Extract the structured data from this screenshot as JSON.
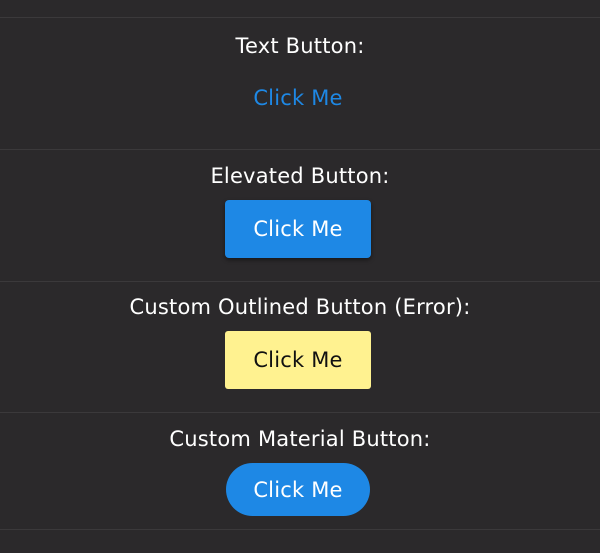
{
  "sections": {
    "text_button": {
      "label": "Text Button:",
      "button_label": "Click Me"
    },
    "elevated_button": {
      "label": "Elevated Button:",
      "button_label": "Click Me"
    },
    "outlined_button": {
      "label": "Custom Outlined Button (Error):",
      "button_label": "Click Me"
    },
    "material_button": {
      "label": "Custom Material Button:",
      "button_label": "Click Me"
    }
  },
  "colors": {
    "background": "#2b292b",
    "divider": "#3b393b",
    "accent_blue": "#1e88e5",
    "error_yellow": "#fff290",
    "text": "#ffffff"
  }
}
